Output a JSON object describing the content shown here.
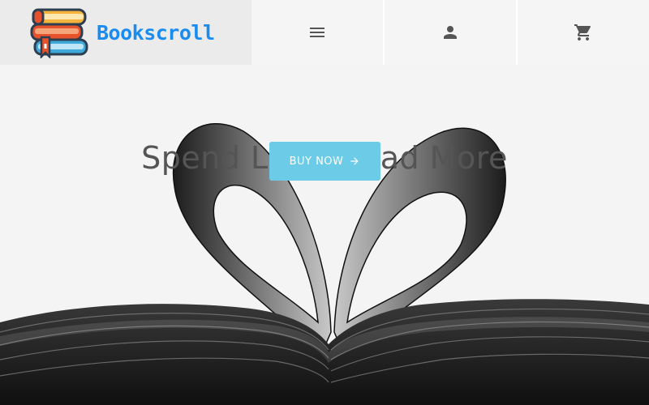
{
  "header": {
    "brand": {
      "name": "Bookscroll",
      "logo_icon": "stacked-books-icon"
    },
    "nav": [
      {
        "id": "menu",
        "icon": "hamburger-menu-icon"
      },
      {
        "id": "account",
        "icon": "person-icon"
      },
      {
        "id": "cart",
        "icon": "shopping-cart-icon"
      }
    ]
  },
  "hero": {
    "title": "Spend Less, Read More",
    "cta_label": "BUY NOW",
    "cta_icon": "arrow-right-icon",
    "background": "heart-shaped-book-pages-photo"
  },
  "colors": {
    "brand": "#1a8cf0",
    "cta": "#6ccbe6",
    "title": "#555555",
    "icons": "#555555"
  }
}
